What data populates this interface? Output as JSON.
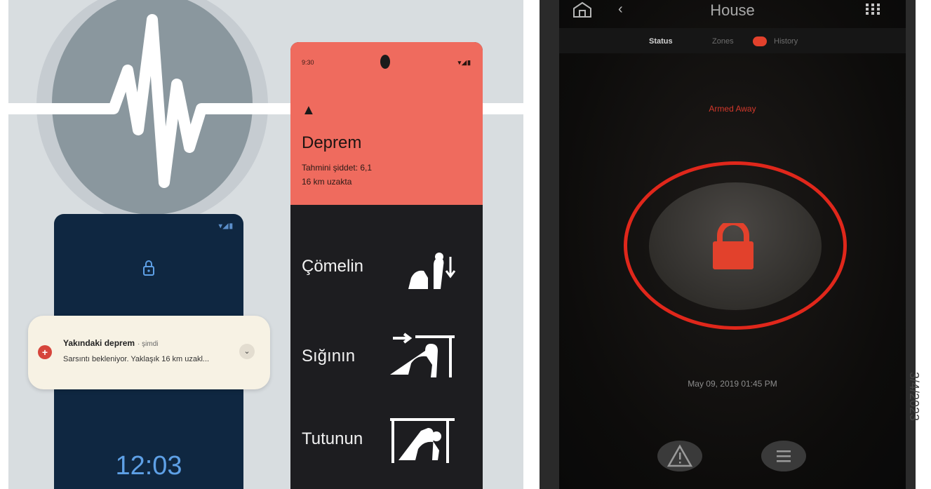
{
  "left": {
    "lock_screen": {
      "status_icons": "▾◢▮",
      "clock": "12:03"
    },
    "notification": {
      "title": "Yakındaki deprem",
      "time": "· şimdi",
      "body": "Sarsıntı bekleniyor. Yaklaşık 16 km uzakl..."
    },
    "alert_phone": {
      "status_time": "9:30",
      "status_icons": "▾◢▮",
      "warning_symbol": "▲",
      "title": "Deprem",
      "magnitude": "Tahmini şiddet: 6,1",
      "distance": "16 km uzakta",
      "steps": [
        {
          "label": "Çömelin",
          "icon": "crouch-icon"
        },
        {
          "label": "Sığının",
          "icon": "cover-icon"
        },
        {
          "label": "Tutunun",
          "icon": "hold-icon"
        }
      ]
    },
    "colors": {
      "alert_red": "#ef6b5e",
      "lock_screen_navy": "#0f2741",
      "clock_blue": "#5ea0e6"
    }
  },
  "right": {
    "nav": {
      "title": "House",
      "back": "‹",
      "home_icon": "home-icon",
      "menu_icon": "grid-menu-icon"
    },
    "tabs": {
      "status": "Status",
      "zones": "Zones",
      "history": "History"
    },
    "arm_state": "Armed Away",
    "datetime": "May 09, 2019  01:45 PM",
    "buttons": [
      {
        "icon": "warning-icon"
      },
      {
        "icon": "menu-list-icon"
      }
    ],
    "colors": {
      "armed_red": "#e0271b",
      "lock_red": "#e2412c"
    }
  },
  "side_date": "3/4/2023"
}
